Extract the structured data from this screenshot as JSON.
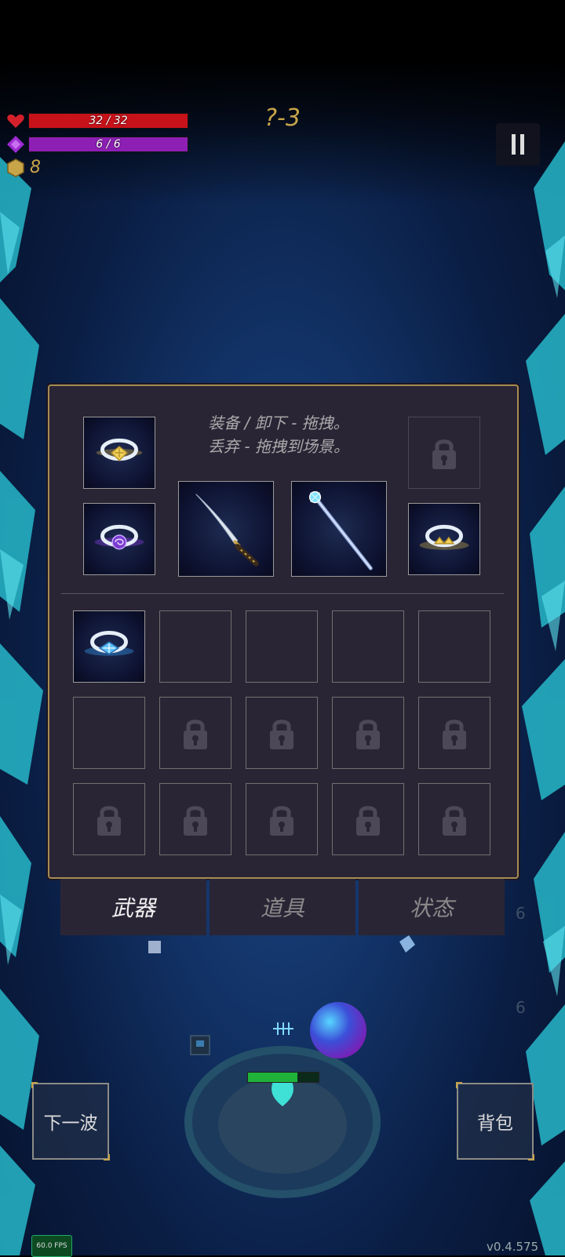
{
  "hud": {
    "hp_text": "32 / 32",
    "hp_fraction": 1.0,
    "mp_text": "6 / 6",
    "mp_fraction": 1.0,
    "coins": "8",
    "level": "?-3",
    "hp_color": "#c8121a",
    "mp_color": "#8e1fb5",
    "coin_color": "#c9a54a"
  },
  "inventory": {
    "hint_line1": "装备 / 卸下 - 拖拽。",
    "hint_line2": "丢弃 - 拖拽到场景。",
    "equipped": [
      {
        "item": "gold-ring-icon",
        "state": "filled"
      },
      {
        "item": "purple-ring-icon",
        "state": "filled"
      },
      {
        "item": "katana-icon",
        "state": "filled"
      },
      {
        "item": "ice-staff-icon",
        "state": "filled"
      },
      {
        "item": "lock-icon",
        "state": "locked"
      },
      {
        "item": "gold-ring-icon",
        "state": "filled"
      }
    ],
    "bag_slots": [
      {
        "item": "blue-ring-icon",
        "state": "filled"
      },
      {
        "item": "",
        "state": "empty"
      },
      {
        "item": "",
        "state": "empty"
      },
      {
        "item": "",
        "state": "empty"
      },
      {
        "item": "",
        "state": "empty"
      },
      {
        "item": "",
        "state": "empty"
      },
      {
        "item": "lock-icon",
        "state": "locked"
      },
      {
        "item": "lock-icon",
        "state": "locked"
      },
      {
        "item": "lock-icon",
        "state": "locked"
      },
      {
        "item": "lock-icon",
        "state": "locked"
      },
      {
        "item": "lock-icon",
        "state": "locked"
      },
      {
        "item": "lock-icon",
        "state": "locked"
      },
      {
        "item": "lock-icon",
        "state": "locked"
      },
      {
        "item": "lock-icon",
        "state": "locked"
      },
      {
        "item": "lock-icon",
        "state": "locked"
      }
    ]
  },
  "tabs": [
    {
      "label": "武器",
      "active": true
    },
    {
      "label": "道具",
      "active": false
    },
    {
      "label": "状态",
      "active": false
    }
  ],
  "bottom": {
    "next_wave_label": "下一波",
    "backpack_label": "背包",
    "fps": "60.0 FPS",
    "version": "v0.4.575",
    "faded_number_1": "6",
    "faded_number_2": "6",
    "hero_hp_fraction": 0.7
  }
}
